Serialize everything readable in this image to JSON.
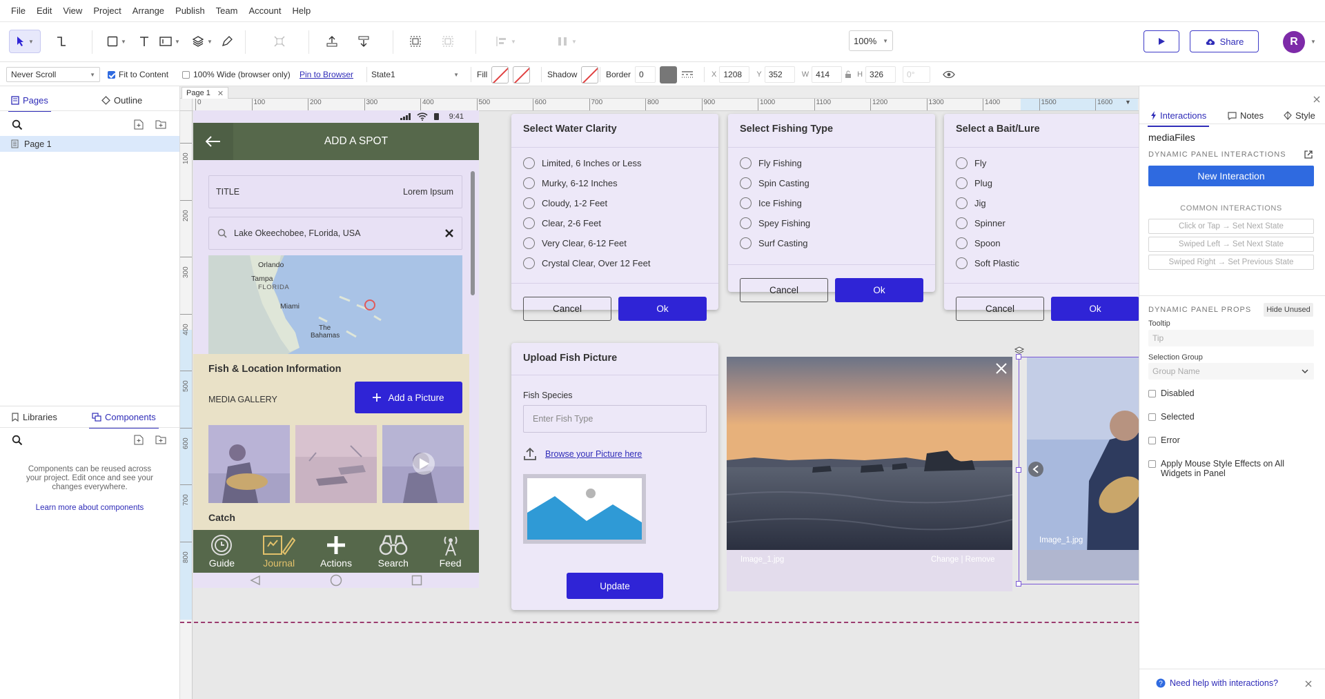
{
  "menu": [
    "File",
    "Edit",
    "View",
    "Project",
    "Arrange",
    "Publish",
    "Team",
    "Account",
    "Help"
  ],
  "toolbar": {
    "zoom": "100%",
    "share_label": "Share",
    "avatar_letter": "R"
  },
  "propsbar": {
    "scroll_option": "Never Scroll",
    "fit_to_content": "Fit to Content",
    "wide_browser": "100% Wide (browser only)",
    "pin_to_browser": "Pin to Browser",
    "state": "State1",
    "fill_label": "Fill",
    "shadow_label": "Shadow",
    "border_label": "Border",
    "border_value": "0",
    "x_label": "X",
    "x": "1208",
    "y_label": "Y",
    "y": "352",
    "w_label": "W",
    "w": "414",
    "h_label": "H",
    "h": "326",
    "rotation": "0°"
  },
  "leftpanel": {
    "tab_pages": "Pages",
    "tab_outline": "Outline",
    "page_item": "Page 1",
    "tab_libraries": "Libraries",
    "tab_components": "Components",
    "components_empty": "Components can be reused across your project. Edit once and see your changes everywhere.",
    "components_link": "Learn more about components"
  },
  "canvas": {
    "page_tab": "Page 1",
    "ruler_h": [
      "0",
      "100",
      "200",
      "300",
      "400",
      "500",
      "600",
      "700",
      "800",
      "900",
      "1000",
      "1100",
      "1200",
      "1300",
      "1400",
      "1500",
      "1600"
    ],
    "ruler_v": [
      "100",
      "200",
      "300",
      "400",
      "500",
      "600",
      "700",
      "800"
    ]
  },
  "phone": {
    "time": "9:41",
    "header_title": "ADD A SPOT",
    "title_label": "TITLE",
    "title_value": "Lorem Ipsum",
    "location_value": "Lake Okeechobee, FLorida, USA",
    "map_labels": {
      "orlando": "Orlando",
      "tampa": "Tampa",
      "florida": "FLORIDA",
      "miami": "Miami",
      "bahamas_1": "The",
      "bahamas_2": "Bahamas"
    },
    "section_title": "Fish & Location Information",
    "media_gallery": "MEDIA GALLERY",
    "add_picture": "Add a Picture",
    "catch_label": "Catch",
    "nav": [
      "Guide",
      "Journal",
      "Actions",
      "Search",
      "Feed"
    ]
  },
  "dialogs": {
    "water": {
      "title": "Select Water Clarity",
      "options": [
        "Limited, 6 Inches or Less",
        "Murky, 6-12 Inches",
        "Cloudy, 1-2 Feet",
        "Clear, 2-6 Feet",
        "Very Clear, 6-12 Feet",
        "Crystal Clear, Over 12 Feet"
      ],
      "cancel": "Cancel",
      "ok": "Ok"
    },
    "fishing": {
      "title": "Select Fishing Type",
      "options": [
        "Fly Fishing",
        "Spin Casting",
        "Ice Fishing",
        "Spey Fishing",
        "Surf Casting"
      ],
      "cancel": "Cancel",
      "ok": "Ok"
    },
    "bait": {
      "title": "Select a Bait/Lure",
      "options": [
        "Fly",
        "Plug",
        "Jig",
        "Spinner",
        "Spoon",
        "Soft Plastic"
      ],
      "cancel": "Cancel",
      "ok": "Ok"
    },
    "upload": {
      "title": "Upload Fish Picture",
      "species_label": "Fish Species",
      "species_placeholder": "Enter Fish Type",
      "browse": "Browse your Picture here",
      "update": "Update"
    }
  },
  "gallery_viewer": {
    "caption": "Image_1.jpg",
    "actions": "Change | Remove"
  },
  "carousel": {
    "caption": "Image_1.jpg"
  },
  "rightpanel": {
    "tab_interactions": "Interactions",
    "tab_notes": "Notes",
    "tab_style": "Style",
    "widget_name": "mediaFiles",
    "dp_interactions": "DYNAMIC PANEL INTERACTIONS",
    "new_interaction": "New Interaction",
    "common_interactions": "COMMON INTERACTIONS",
    "common_items": [
      "Click or Tap → Set Next State",
      "Swiped Left → Set Next State",
      "Swiped Right → Set Previous State"
    ],
    "dp_props": "DYNAMIC PANEL PROPS",
    "hide_unused": "Hide Unused",
    "tooltip_label": "Tooltip",
    "tooltip_placeholder": "Tip",
    "selection_group_label": "Selection Group",
    "selection_group_value": "Group Name",
    "checkboxes": [
      "Disabled",
      "Selected",
      "Error",
      "Apply Mouse Style Effects on All Widgets in Panel"
    ],
    "help_link": "Need help with interactions?"
  },
  "colors": {
    "accent": "#2f24d6",
    "dialog_bg": "#ede8f8",
    "phone_header": "#56684b",
    "brand_purple": "#7d2aa8"
  }
}
